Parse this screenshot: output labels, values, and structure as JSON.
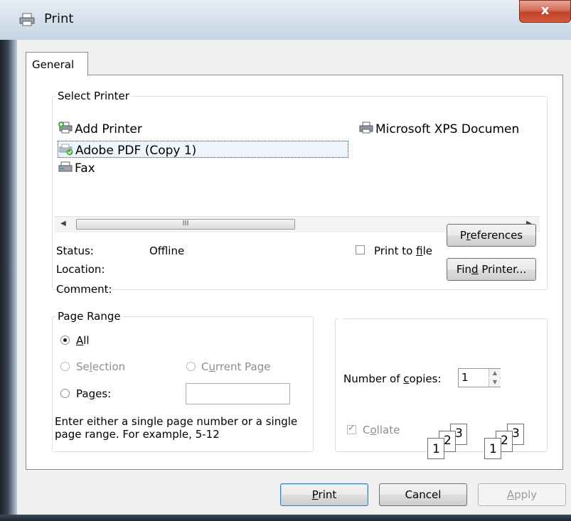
{
  "window": {
    "title": "Print",
    "close_glyph": "x"
  },
  "tabs": [
    {
      "label": "General"
    }
  ],
  "select_printer": {
    "legend": "Select Printer",
    "printers": [
      {
        "name": "Add Printer",
        "icon": "add-printer-icon"
      },
      {
        "name": "Adobe PDF (Copy 1)",
        "icon": "pdf-printer-icon",
        "selected": true
      },
      {
        "name": "Fax",
        "icon": "fax-icon"
      },
      {
        "name": "Microsoft XPS Documen",
        "icon": "printer-icon"
      }
    ],
    "scroll_thumb_mark": "III",
    "status_label": "Status:",
    "status_value": "Offline",
    "location_label": "Location:",
    "comment_label": "Comment:",
    "print_to_file": {
      "prefix": "Print to ",
      "hotkey": "f",
      "suffix": "ile",
      "checked": false
    },
    "preferences": {
      "prefix": "P",
      "hotkey": "r",
      "suffix": "eferences"
    },
    "find_printer": {
      "prefix": "Fin",
      "hotkey": "d",
      "suffix": " Printer..."
    }
  },
  "page_range": {
    "legend": "Page Range",
    "all": {
      "hotkey": "A",
      "suffix": "ll",
      "selected": true
    },
    "selection": {
      "label": "Selection",
      "hotkey_prefix": "Se",
      "hotkey": "l",
      "suffix": "ection",
      "enabled": false
    },
    "current_page": {
      "prefix": "C",
      "hotkey": "u",
      "suffix": "rrent Page",
      "enabled": false
    },
    "pages": {
      "hotkey": "g",
      "prefix": "Pa",
      "suffix": "es:",
      "value": ""
    },
    "hint_line1": "Enter either a single page number or a single",
    "hint_line2": "page range.  For example, 5-12"
  },
  "copies": {
    "label_prefix": "Number of ",
    "label_hotkey": "c",
    "label_suffix": "opies:",
    "value": "1",
    "collate": {
      "prefix": "C",
      "hotkey": "o",
      "suffix": "llate",
      "checked": true,
      "enabled": false
    },
    "collate_pages": [
      "1",
      "2",
      "3"
    ]
  },
  "buttons": {
    "print": {
      "hotkey": "P",
      "suffix": "rint"
    },
    "cancel": "Cancel",
    "apply": {
      "hotkey": "A",
      "suffix": "pply"
    }
  }
}
